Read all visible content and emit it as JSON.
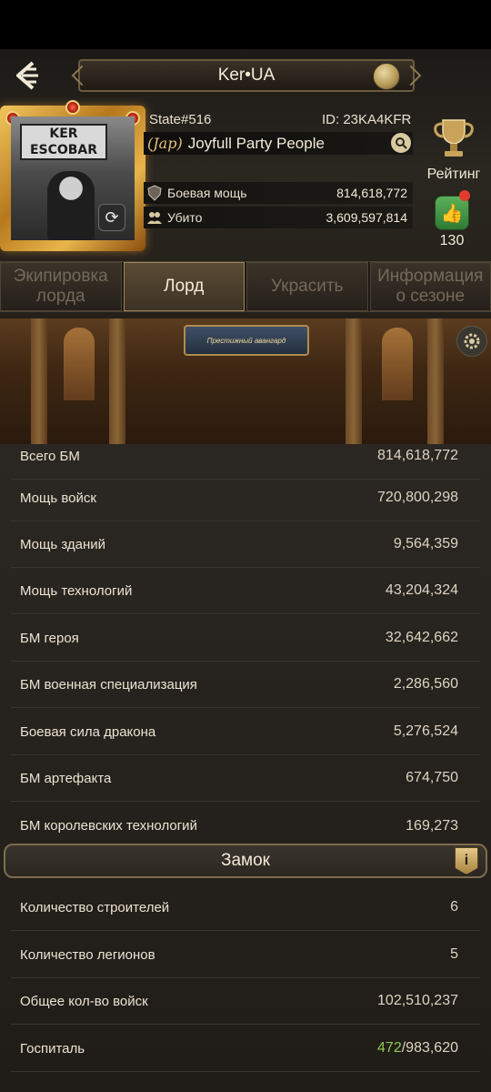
{
  "header": {
    "title": "Ker•UA",
    "state": "State#516",
    "id": "ID: 23KA4KFR",
    "avatar_sign": "KER ESCOBAR",
    "alliance_tag": "(Jap)",
    "alliance_name": "Joyfull Party People",
    "power_label": "Боевая мощь",
    "power_value": "814,618,772",
    "kills_label": "Убито",
    "kills_value": "3,609,597,814",
    "rank_label": "Рейтинг",
    "likes": "130"
  },
  "tabs": [
    {
      "label": "Экипировка лорда",
      "active": false
    },
    {
      "label": "Лорд",
      "active": true
    },
    {
      "label": "Украсить",
      "active": false
    },
    {
      "label": "Информация о сезоне",
      "active": false
    }
  ],
  "banner": {
    "title": "Престижный авангард"
  },
  "stats": [
    {
      "label": "Всего БМ",
      "value": "814,618,772"
    },
    {
      "label": "Мощь войск",
      "value": "720,800,298"
    },
    {
      "label": "Мощь зданий",
      "value": "9,564,359"
    },
    {
      "label": "Мощь технологий",
      "value": "43,204,324"
    },
    {
      "label": "БМ героя",
      "value": "32,642,662"
    },
    {
      "label": "БМ военная специализация",
      "value": "2,286,560"
    },
    {
      "label": "Боевая сила дракона",
      "value": "5,276,524"
    },
    {
      "label": "БМ артефакта",
      "value": "674,750"
    },
    {
      "label": "БМ королевских технологий",
      "value": "169,273"
    }
  ],
  "castle": {
    "title": "Замок",
    "rows": [
      {
        "label": "Количество строителей",
        "value": "6"
      },
      {
        "label": "Количество легионов",
        "value": "5"
      },
      {
        "label": "Общее кол-во войск",
        "value": "102,510,237"
      }
    ],
    "hospital_label": "Госпиталь",
    "hospital_current": "472",
    "hospital_total": "/983,620"
  }
}
